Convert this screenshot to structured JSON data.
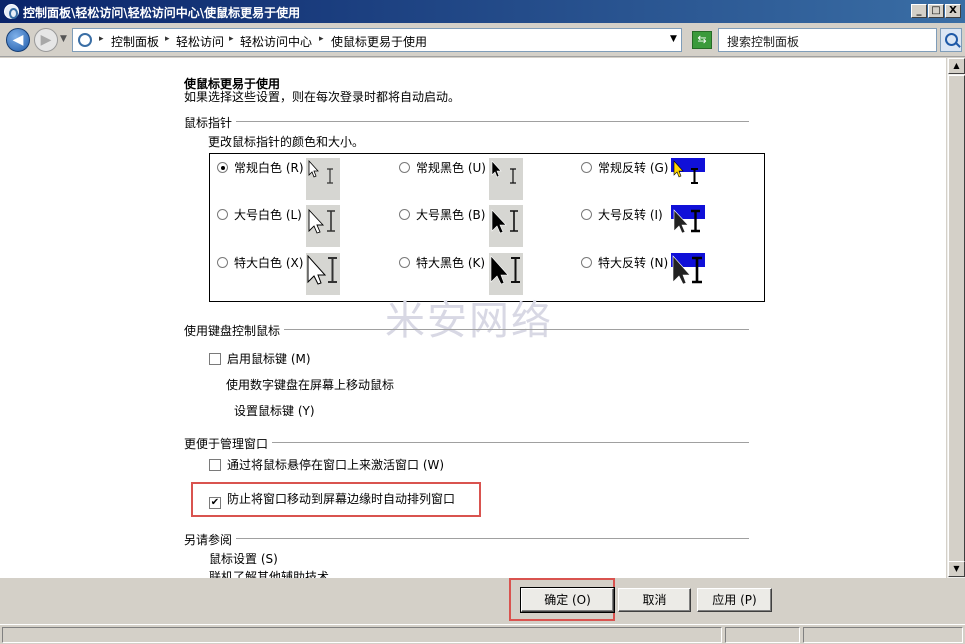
{
  "window": {
    "title": "控制面板\\轻松访问\\轻松访问中心\\使鼠标更易于使用",
    "min": "_",
    "max": "□",
    "close": "X"
  },
  "nav": {
    "back": "◀",
    "forward": "▶",
    "breadcrumbs": [
      "控制面板",
      "轻松访问",
      "轻松访问中心",
      "使鼠标更易于使用"
    ],
    "separator": "▸",
    "search_placeholder": "搜索控制面板"
  },
  "page": {
    "heading": "使鼠标更易于使用",
    "description": "如果选择这些设置，则在每次登录时都将自动启动。"
  },
  "pointer_section": {
    "title": "鼠标指针",
    "subtitle": "更改鼠标指针的颜色和大小。",
    "options": [
      {
        "label": "常规白色 (R)",
        "selected": true
      },
      {
        "label": "常规黑色 (U)",
        "selected": false
      },
      {
        "label": "常规反转 (G)",
        "selected": false
      },
      {
        "label": "大号白色 (L)",
        "selected": false
      },
      {
        "label": "大号黑色 (B)",
        "selected": false
      },
      {
        "label": "大号反转 (I)",
        "selected": false
      },
      {
        "label": "特大白色 (X)",
        "selected": false
      },
      {
        "label": "特大黑色 (K)",
        "selected": false
      },
      {
        "label": "特大反转 (N)",
        "selected": false
      }
    ]
  },
  "keyboard_section": {
    "title": "使用键盘控制鼠标",
    "mousekeys_label": "启用鼠标键 (M)",
    "mousekeys_checked": false,
    "mousekeys_desc": "使用数字键盘在屏幕上移动鼠标",
    "setup_link": "设置鼠标键 (Y)"
  },
  "window_section": {
    "title": "更便于管理窗口",
    "hover_label": "通过将鼠标悬停在窗口上来激活窗口 (W)",
    "hover_checked": false,
    "snap_label": "防止将窗口移动到屏幕边缘时自动排列窗口",
    "snap_checked": true
  },
  "see_also": {
    "title": "另请参阅",
    "link1": "鼠标设置 (S)",
    "link2": "联机了解其他辅助技术"
  },
  "buttons": {
    "ok": "确定 (O)",
    "cancel": "取消",
    "apply": "应用 (P)"
  },
  "watermark": "米安网络",
  "colors": {
    "highlight_box": "#d9534f",
    "inverted_band": "#1010d8"
  }
}
